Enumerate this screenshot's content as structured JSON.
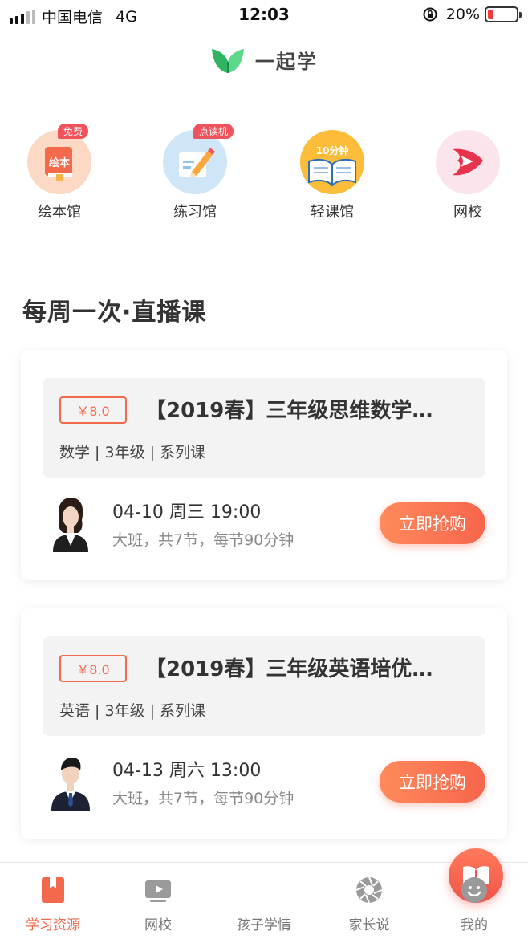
{
  "status_bar": {
    "carrier": "中国电信",
    "network": "4G",
    "time": "12:03",
    "battery": "20%",
    "battery_level": 0.2
  },
  "header": {
    "app_name": "一起学"
  },
  "categories": [
    {
      "label": "绘本馆",
      "badge": "免费",
      "icon": "picture-book-icon",
      "icon_text": "绘本"
    },
    {
      "label": "练习馆",
      "badge": "点读机",
      "icon": "pencil-icon"
    },
    {
      "label": "轻课馆",
      "icon": "open-book-icon",
      "icon_text": "10分钟"
    },
    {
      "label": "网校",
      "icon": "play-logo-icon"
    }
  ],
  "section": {
    "title": "每周一次·直播课"
  },
  "courses": [
    {
      "price": "￥8.0",
      "title": "【2019春】三年级思维数学…",
      "meta": "数学 | 3年级 | 系列课",
      "time": "04-10 周三 19:00",
      "desc": "大班，共7节，每节90分钟",
      "button": "立即抢购"
    },
    {
      "price": "￥8.0",
      "title": "【2019春】三年级英语培优…",
      "meta": "英语 | 3年级 | 系列课",
      "time": "04-13 周六 13:00",
      "desc": "大班，共7节，每节90分钟",
      "button": "立即抢购"
    }
  ],
  "tabbar": {
    "tabs": [
      {
        "label": "学习资源",
        "active": true,
        "icon": "bookmark-book-icon"
      },
      {
        "label": "网校",
        "active": false,
        "icon": "video-play-icon"
      },
      {
        "label": "孩子学情",
        "active": false,
        "icon": "open-book-icon"
      },
      {
        "label": "家长说",
        "active": false,
        "icon": "aperture-icon"
      },
      {
        "label": "我的",
        "active": false,
        "icon": "smiley-icon"
      }
    ]
  },
  "colors": {
    "accent": "#f26a4b",
    "badge": "#f0535b",
    "brand_green": "#3cc46a"
  }
}
